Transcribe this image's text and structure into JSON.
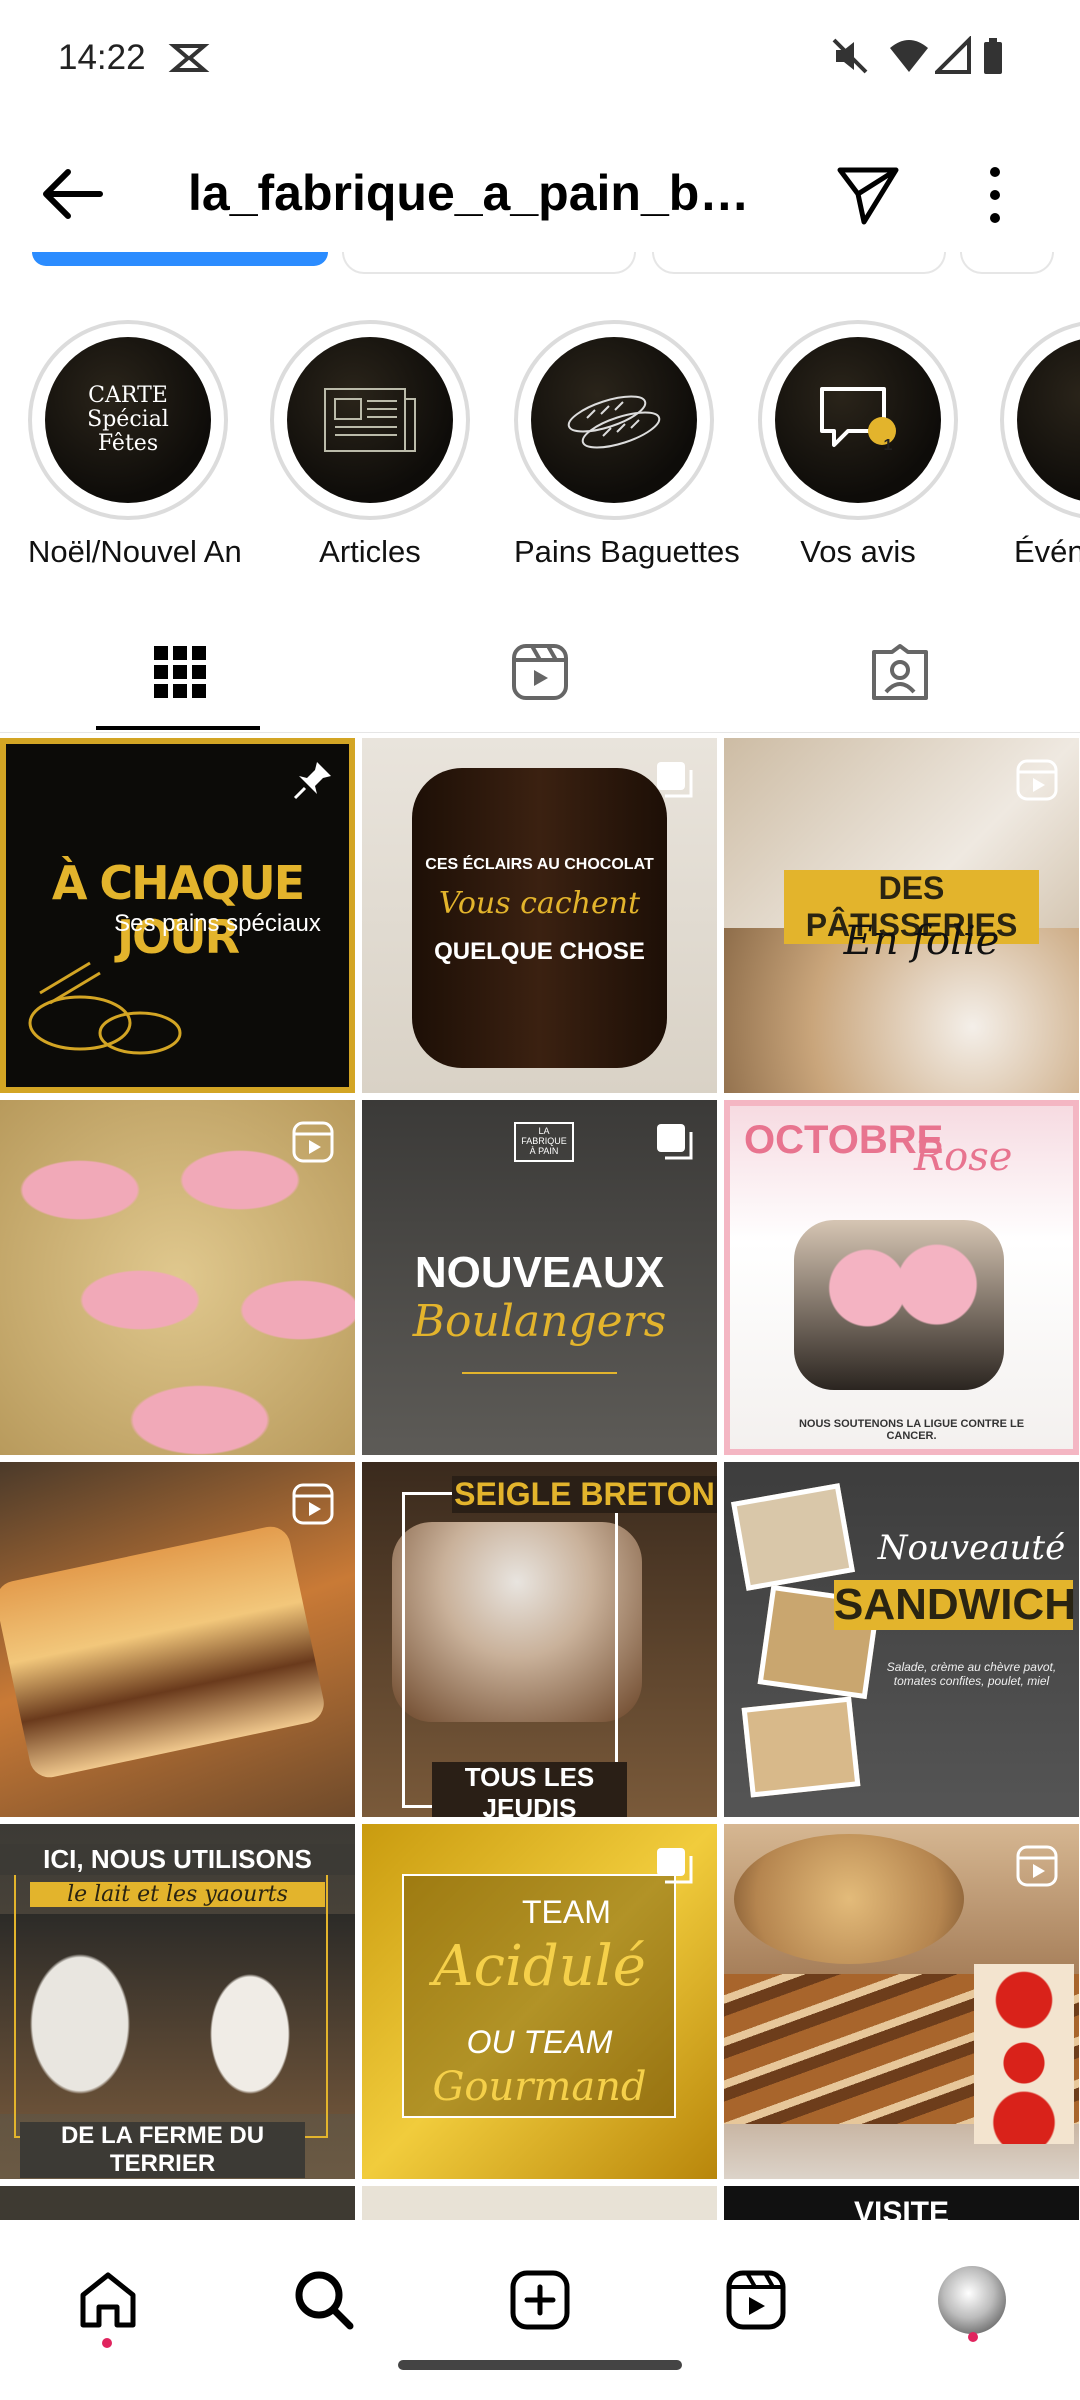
{
  "status_bar": {
    "time": "14:22"
  },
  "header": {
    "title": "la_fabrique_a_pain_bo…"
  },
  "highlights": [
    {
      "label": "Noël/Nouvel An",
      "cover_text": "CARTE Spécial Fêtes"
    },
    {
      "label": "Articles"
    },
    {
      "label": "Pains Baguettes"
    },
    {
      "label": "Vos avis",
      "badge": "1"
    },
    {
      "label": "Évén"
    }
  ],
  "tabs": [
    {
      "name": "grid",
      "icon": "grid-icon",
      "active": true
    },
    {
      "name": "reels",
      "icon": "reels-icon",
      "active": false
    },
    {
      "name": "tagged",
      "icon": "tagged-icon",
      "active": false
    }
  ],
  "posts": [
    {
      "line1": "À CHAQUE JOUR",
      "line2": "Ses pains spéciaux",
      "badge": "pin-icon"
    },
    {
      "line1": "CES ÉCLAIRS AU CHOCOLAT",
      "line2": "Vous cachent",
      "line3": "QUELQUE CHOSE",
      "badge": "carousel-icon"
    },
    {
      "line1": "DES PÂTISSERIES",
      "line2": "En folie",
      "badge": "reel-icon"
    },
    {
      "badge": "reel-icon"
    },
    {
      "line1": "NOUVEAUX",
      "line2": "Boulangers",
      "logo": "LA FABRIQUE À PAIN",
      "badge": "carousel-icon"
    },
    {
      "line1": "OCTOBRE",
      "line2": "Rose",
      "line3": "NOUS SOUTENONS LA LIGUE CONTRE LE CANCER.",
      "badge": "none"
    },
    {
      "badge": "reel-icon"
    },
    {
      "line1": "SEIGLE BRETON",
      "line2": "TOUS LES JEUDIS",
      "badge": "none"
    },
    {
      "line1": "Nouveauté",
      "line2": "SANDWICH",
      "line3": "Salade, crème au chèvre pavot, tomates confites, poulet, miel",
      "badge": "none"
    },
    {
      "line1": "ICI, NOUS UTILISONS",
      "line2": "le lait et les yaourts",
      "line3": "DE LA FERME DU TERRIER",
      "badge": "none"
    },
    {
      "line1": "TEAM",
      "line2": "Acidulé",
      "line3": "OU TEAM",
      "line4": "Gourmand",
      "badge": "carousel-icon"
    },
    {
      "badge": "reel-icon"
    },
    {
      "line1": "VISITE"
    }
  ],
  "bottom_nav": [
    {
      "name": "home",
      "icon": "home-icon"
    },
    {
      "name": "search",
      "icon": "search-icon"
    },
    {
      "name": "create",
      "icon": "add-post-icon"
    },
    {
      "name": "reels",
      "icon": "reels-icon"
    },
    {
      "name": "profile",
      "icon": "avatar"
    }
  ],
  "colors": {
    "gold": "#e3b42c",
    "pink": "#e8748f",
    "accent": "#2b8cff",
    "notify": "#e0245e"
  }
}
